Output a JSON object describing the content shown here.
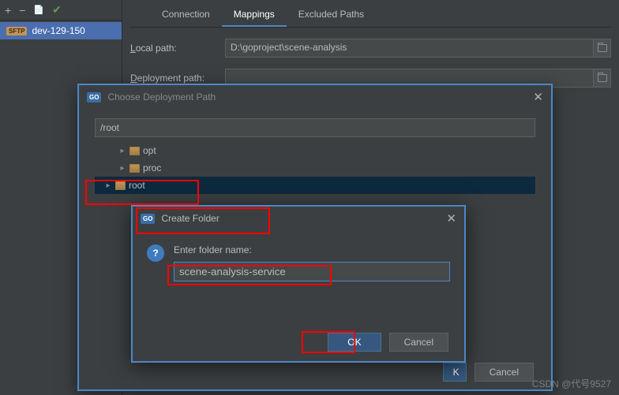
{
  "sidebar": {
    "server_name": "dev-129-150",
    "sftp_label": "SFTP"
  },
  "tabs": {
    "connection": "Connection",
    "mappings": "Mappings",
    "excluded": "Excluded Paths"
  },
  "form": {
    "local_path_prefix": "L",
    "local_path_rest": "ocal path:",
    "local_path_value": "D:\\goproject\\scene-analysis",
    "deploy_path_prefix": "D",
    "deploy_path_rest": "eployment path:",
    "deploy_path_value": ""
  },
  "outer_dialog": {
    "go_label": "GO",
    "title": "Choose Deployment Path",
    "root_path": "/root",
    "tree": [
      {
        "name": "opt",
        "selected": false
      },
      {
        "name": "proc",
        "selected": false
      },
      {
        "name": "root",
        "selected": true
      }
    ],
    "ok_partial": "K",
    "cancel": "Cancel"
  },
  "inner_dialog": {
    "go_label": "GO",
    "title": "Create Folder",
    "help_glyph": "?",
    "prompt": "Enter folder name:",
    "value": "scene-analysis-service",
    "ok": "OK",
    "cancel": "Cancel"
  },
  "watermark": "CSDN @代号9527"
}
